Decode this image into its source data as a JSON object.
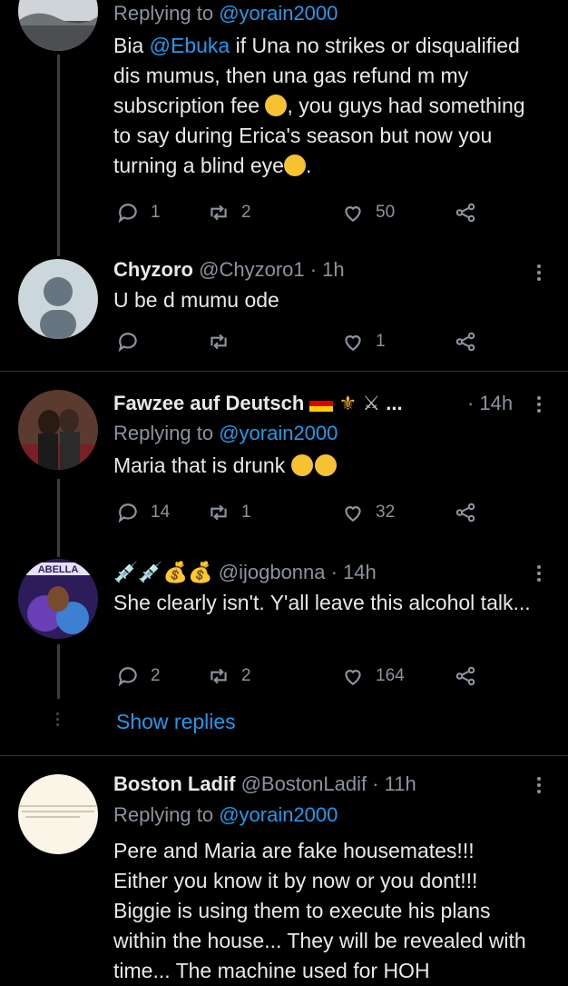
{
  "tweets": [
    {
      "reply_prefix": "Replying to ",
      "reply_handle": "@yorain2000",
      "body_1": "Bia ",
      "mention": "@Ebuka",
      "body_2": " if Una no strikes or disqualified dis mumus, then una gas refund m my subscription fee ",
      "body_3": ", you guys had something to say during Erica's season but now you turning a blind eye",
      "body_4": ".",
      "replies": "1",
      "retweets": "2",
      "likes": "50"
    },
    {
      "name": "Chyzoro",
      "handle": "@Chyzoro1",
      "time": " · 1h",
      "body": "U be d mumu ode",
      "replies": "",
      "retweets": "",
      "likes": "1"
    },
    {
      "name": "Fawzee auf Deutsch",
      "ellipsis": "...",
      "time": "· 14h",
      "reply_prefix": "Replying to ",
      "reply_handle": "@yorain2000",
      "body": "Maria that is drunk ",
      "replies": "14",
      "retweets": "1",
      "likes": "32"
    },
    {
      "handle": "@ijogbonna",
      "time": " · 14h",
      "body": "She clearly isn't. Y'all leave this alcohol talk...",
      "replies": "2",
      "retweets": "2",
      "likes": "164",
      "avatar_text": "ABELLA"
    },
    {
      "show_replies": "Show replies"
    },
    {
      "name": "Boston Ladif",
      "handle": "@BostonLadif",
      "time": " · 11h",
      "reply_prefix": "Replying to ",
      "reply_handle": "@yorain2000",
      "body": "Pere and Maria are fake housemates!!! Either you know it by now or you dont!!! Biggie is using them to execute his plans within the house... They will be revealed with time... The machine used for HOH",
      "avatar_text": "Stay away from people who think you're a good person"
    }
  ],
  "icons": [
    "reply-icon",
    "retweet-icon",
    "like-icon",
    "share-icon",
    "more-icon"
  ],
  "colors": {
    "accent": "#1d9bf0",
    "muted": "#8b949e",
    "background": "#000000"
  }
}
